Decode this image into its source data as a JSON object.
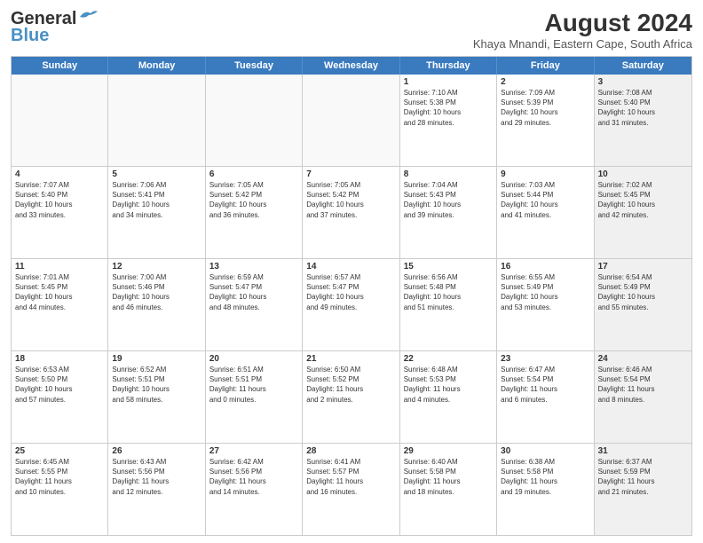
{
  "header": {
    "logo_general": "General",
    "logo_blue": "Blue",
    "month_year": "August 2024",
    "location": "Khaya Mnandi, Eastern Cape, South Africa"
  },
  "weekdays": [
    "Sunday",
    "Monday",
    "Tuesday",
    "Wednesday",
    "Thursday",
    "Friday",
    "Saturday"
  ],
  "rows": [
    [
      {
        "day": "",
        "info": "",
        "empty": true
      },
      {
        "day": "",
        "info": "",
        "empty": true
      },
      {
        "day": "",
        "info": "",
        "empty": true
      },
      {
        "day": "",
        "info": "",
        "empty": true
      },
      {
        "day": "1",
        "info": "Sunrise: 7:10 AM\nSunset: 5:38 PM\nDaylight: 10 hours\nand 28 minutes."
      },
      {
        "day": "2",
        "info": "Sunrise: 7:09 AM\nSunset: 5:39 PM\nDaylight: 10 hours\nand 29 minutes."
      },
      {
        "day": "3",
        "info": "Sunrise: 7:08 AM\nSunset: 5:40 PM\nDaylight: 10 hours\nand 31 minutes.",
        "shaded": true
      }
    ],
    [
      {
        "day": "4",
        "info": "Sunrise: 7:07 AM\nSunset: 5:40 PM\nDaylight: 10 hours\nand 33 minutes."
      },
      {
        "day": "5",
        "info": "Sunrise: 7:06 AM\nSunset: 5:41 PM\nDaylight: 10 hours\nand 34 minutes."
      },
      {
        "day": "6",
        "info": "Sunrise: 7:05 AM\nSunset: 5:42 PM\nDaylight: 10 hours\nand 36 minutes."
      },
      {
        "day": "7",
        "info": "Sunrise: 7:05 AM\nSunset: 5:42 PM\nDaylight: 10 hours\nand 37 minutes."
      },
      {
        "day": "8",
        "info": "Sunrise: 7:04 AM\nSunset: 5:43 PM\nDaylight: 10 hours\nand 39 minutes."
      },
      {
        "day": "9",
        "info": "Sunrise: 7:03 AM\nSunset: 5:44 PM\nDaylight: 10 hours\nand 41 minutes."
      },
      {
        "day": "10",
        "info": "Sunrise: 7:02 AM\nSunset: 5:45 PM\nDaylight: 10 hours\nand 42 minutes.",
        "shaded": true
      }
    ],
    [
      {
        "day": "11",
        "info": "Sunrise: 7:01 AM\nSunset: 5:45 PM\nDaylight: 10 hours\nand 44 minutes."
      },
      {
        "day": "12",
        "info": "Sunrise: 7:00 AM\nSunset: 5:46 PM\nDaylight: 10 hours\nand 46 minutes."
      },
      {
        "day": "13",
        "info": "Sunrise: 6:59 AM\nSunset: 5:47 PM\nDaylight: 10 hours\nand 48 minutes."
      },
      {
        "day": "14",
        "info": "Sunrise: 6:57 AM\nSunset: 5:47 PM\nDaylight: 10 hours\nand 49 minutes."
      },
      {
        "day": "15",
        "info": "Sunrise: 6:56 AM\nSunset: 5:48 PM\nDaylight: 10 hours\nand 51 minutes."
      },
      {
        "day": "16",
        "info": "Sunrise: 6:55 AM\nSunset: 5:49 PM\nDaylight: 10 hours\nand 53 minutes."
      },
      {
        "day": "17",
        "info": "Sunrise: 6:54 AM\nSunset: 5:49 PM\nDaylight: 10 hours\nand 55 minutes.",
        "shaded": true
      }
    ],
    [
      {
        "day": "18",
        "info": "Sunrise: 6:53 AM\nSunset: 5:50 PM\nDaylight: 10 hours\nand 57 minutes."
      },
      {
        "day": "19",
        "info": "Sunrise: 6:52 AM\nSunset: 5:51 PM\nDaylight: 10 hours\nand 58 minutes."
      },
      {
        "day": "20",
        "info": "Sunrise: 6:51 AM\nSunset: 5:51 PM\nDaylight: 11 hours\nand 0 minutes."
      },
      {
        "day": "21",
        "info": "Sunrise: 6:50 AM\nSunset: 5:52 PM\nDaylight: 11 hours\nand 2 minutes."
      },
      {
        "day": "22",
        "info": "Sunrise: 6:48 AM\nSunset: 5:53 PM\nDaylight: 11 hours\nand 4 minutes."
      },
      {
        "day": "23",
        "info": "Sunrise: 6:47 AM\nSunset: 5:54 PM\nDaylight: 11 hours\nand 6 minutes."
      },
      {
        "day": "24",
        "info": "Sunrise: 6:46 AM\nSunset: 5:54 PM\nDaylight: 11 hours\nand 8 minutes.",
        "shaded": true
      }
    ],
    [
      {
        "day": "25",
        "info": "Sunrise: 6:45 AM\nSunset: 5:55 PM\nDaylight: 11 hours\nand 10 minutes."
      },
      {
        "day": "26",
        "info": "Sunrise: 6:43 AM\nSunset: 5:56 PM\nDaylight: 11 hours\nand 12 minutes."
      },
      {
        "day": "27",
        "info": "Sunrise: 6:42 AM\nSunset: 5:56 PM\nDaylight: 11 hours\nand 14 minutes."
      },
      {
        "day": "28",
        "info": "Sunrise: 6:41 AM\nSunset: 5:57 PM\nDaylight: 11 hours\nand 16 minutes."
      },
      {
        "day": "29",
        "info": "Sunrise: 6:40 AM\nSunset: 5:58 PM\nDaylight: 11 hours\nand 18 minutes."
      },
      {
        "day": "30",
        "info": "Sunrise: 6:38 AM\nSunset: 5:58 PM\nDaylight: 11 hours\nand 19 minutes."
      },
      {
        "day": "31",
        "info": "Sunrise: 6:37 AM\nSunset: 5:59 PM\nDaylight: 11 hours\nand 21 minutes.",
        "shaded": true
      }
    ]
  ]
}
